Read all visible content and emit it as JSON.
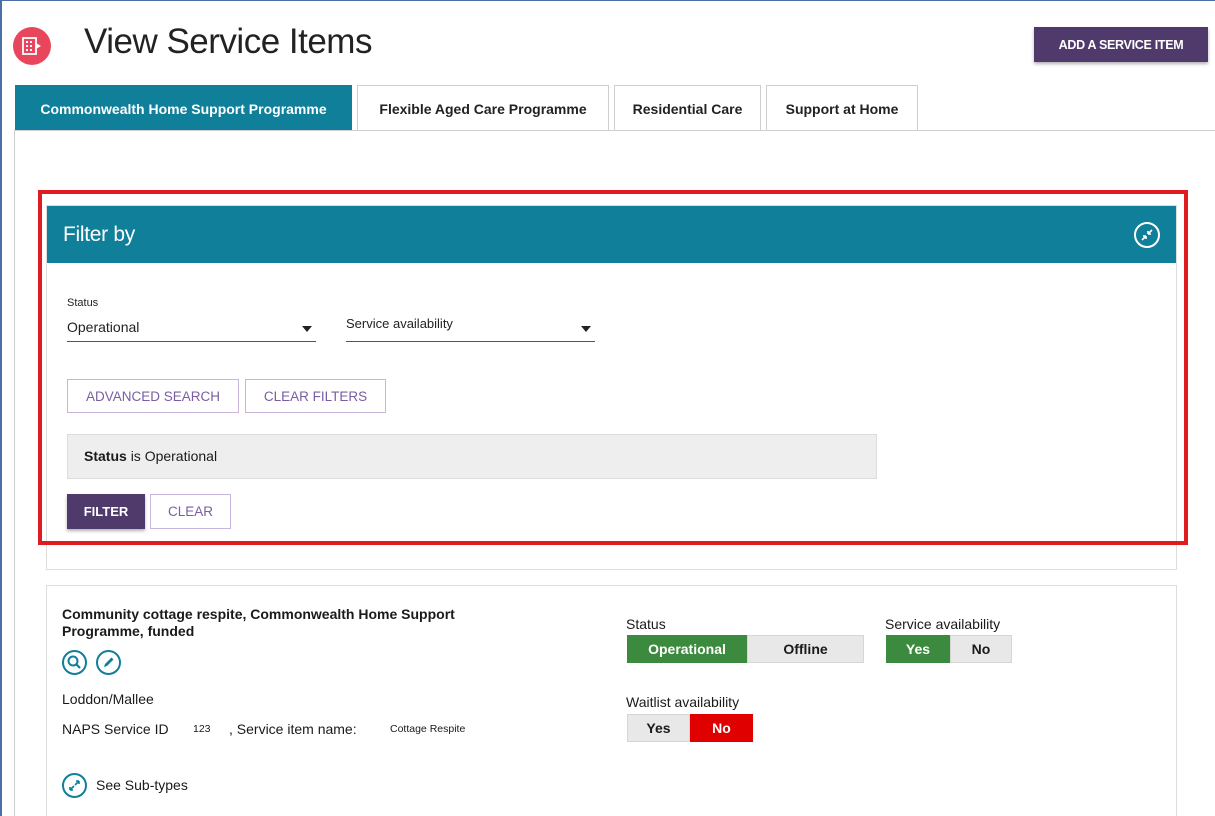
{
  "header": {
    "title": "View Service Items",
    "add_button": "ADD A SERVICE ITEM",
    "app_icon": "building-grid-icon"
  },
  "tabs": [
    {
      "label": "Commonwealth Home Support Programme",
      "active": true
    },
    {
      "label": "Flexible Aged Care Programme",
      "active": false
    },
    {
      "label": "Residential Care",
      "active": false
    },
    {
      "label": "Support at Home",
      "active": false
    }
  ],
  "filter": {
    "title": "Filter by",
    "collapse_icon": "compress-arrows-icon",
    "status_label": "Status",
    "status_value": "Operational",
    "availability_placeholder": "Service availability",
    "advanced_search": "ADVANCED SEARCH",
    "clear_filters": "CLEAR FILTERS",
    "summary_key": "Status",
    "summary_rest": "is Operational",
    "filter_button": "FILTER",
    "clear_button": "CLEAR"
  },
  "service": {
    "title": "Community cottage respite, Commonwealth Home Support Programme, funded",
    "region": "Loddon/Mallee",
    "naps_label": "NAPS Service ID",
    "naps_value": "123",
    "name_label": ", Service item name:",
    "name_value": "Cottage Respite",
    "see_subtypes": "See Sub-types",
    "status_label": "Status",
    "status_options": [
      "Operational",
      "Offline"
    ],
    "status_selected": "Operational",
    "availability_label": "Service availability",
    "availability_options": [
      "Yes",
      "No"
    ],
    "availability_selected": "Yes",
    "waitlist_label": "Waitlist availability",
    "waitlist_options": [
      "Yes",
      "No"
    ],
    "waitlist_selected": "No"
  },
  "colors": {
    "teal": "#0f7f9a",
    "purple": "#4f3a6b",
    "green": "#3c8a3e",
    "red": "#e00000",
    "highlight_outline": "#e01b22"
  }
}
